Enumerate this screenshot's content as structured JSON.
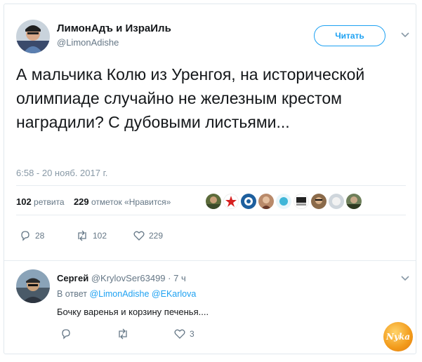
{
  "tweet": {
    "author_name": "ЛимонАдъ и ИзраИль",
    "author_handle": "@LimonAdishe",
    "follow_label": "Читать",
    "text": "А мальчика Колю из Уренгоя, на исторической олимпиаде случайно не железным крестом наградили? С дубовыми листьями...",
    "timestamp": "6:58 - 20 нояб. 2017 г.",
    "retweets_count": "102",
    "retweets_label": "ретвита",
    "likes_count": "229",
    "likes_label": "отметок «Нравится»",
    "actions": {
      "reply_count": "28",
      "retweet_count": "102",
      "like_count": "229"
    }
  },
  "liker_icons": [
    "avatar-icon",
    "avatar-icon",
    "avatar-icon",
    "avatar-icon",
    "avatar-icon",
    "avatar-icon",
    "avatar-icon",
    "avatar-icon",
    "avatar-icon"
  ],
  "reply": {
    "author_name": "Сергей",
    "author_handle": "@KrylovSer63499",
    "time": "· 7 ч",
    "reply_to_prefix": "В ответ",
    "reply_to_user1": "@LimonAdishe",
    "reply_to_user2": "@EKarlova",
    "text": "Бочку варенья и корзину печенья....",
    "actions": {
      "reply_count": "",
      "retweet_count": "",
      "like_count": "3"
    }
  },
  "watermark": {
    "text": "Nyka"
  },
  "colors": {
    "accent": "#1da1f2",
    "text": "#14171a",
    "muted": "#657786",
    "border": "#e1e8ed"
  }
}
